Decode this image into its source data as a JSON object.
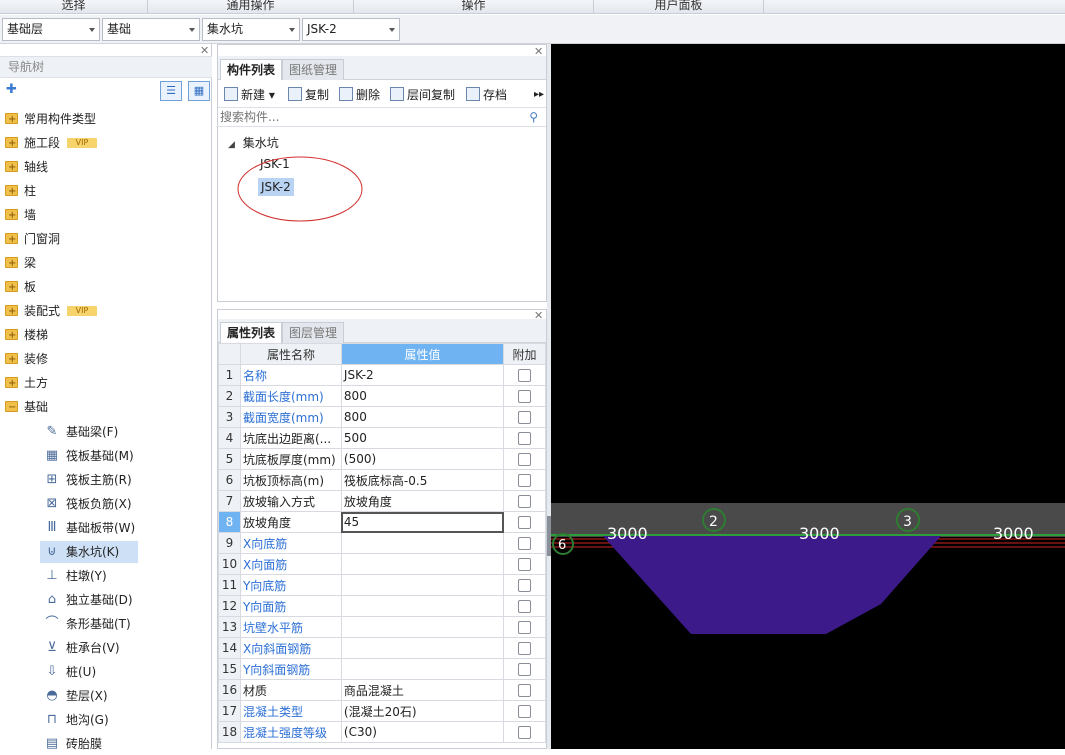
{
  "ribbon": {
    "groups": [
      "选择",
      "通用操作",
      "操作",
      "用户面板"
    ]
  },
  "combos": [
    "基础层",
    "基础",
    "集水坑",
    "JSK-2"
  ],
  "nav": {
    "title": "导航树",
    "categories": [
      {
        "label": "常用构件类型",
        "vip": ""
      },
      {
        "label": "施工段",
        "vip": "VIP"
      },
      {
        "label": "轴线",
        "vip": ""
      },
      {
        "label": "柱",
        "vip": ""
      },
      {
        "label": "墙",
        "vip": ""
      },
      {
        "label": "门窗洞",
        "vip": ""
      },
      {
        "label": "梁",
        "vip": ""
      },
      {
        "label": "板",
        "vip": ""
      },
      {
        "label": "装配式",
        "vip": "VIP"
      },
      {
        "label": "楼梯",
        "vip": ""
      },
      {
        "label": "装修",
        "vip": ""
      },
      {
        "label": "土方",
        "vip": ""
      },
      {
        "label": "基础",
        "vip": ""
      }
    ],
    "foundation_items": [
      "基础梁(F)",
      "筏板基础(M)",
      "筏板主筋(R)",
      "筏板负筋(X)",
      "基础板带(W)",
      "集水坑(K)",
      "柱墩(Y)",
      "独立基础(D)",
      "条形基础(T)",
      "桩承台(V)",
      "桩(U)",
      "垫层(X)",
      "地沟(G)",
      "砖胎膜"
    ],
    "selected_item": "集水坑(K)"
  },
  "component_panel": {
    "tabs": [
      "构件列表",
      "图纸管理"
    ],
    "toolbar": {
      "new": "新建",
      "copy": "复制",
      "delete": "删除",
      "layer_copy": "层间复制",
      "save": "存档"
    },
    "search_placeholder": "搜索构件...",
    "tree_root": "集水坑",
    "components": [
      "JSK-1",
      "JSK-2"
    ],
    "selected": "JSK-2"
  },
  "property_panel": {
    "tabs": [
      "属性列表",
      "图层管理"
    ],
    "headers": {
      "name": "属性名称",
      "value": "属性值",
      "extra": "附加"
    },
    "rows": [
      {
        "n": "1",
        "name": "名称",
        "value": "JSK-2",
        "blue": true
      },
      {
        "n": "2",
        "name": "截面长度(mm)",
        "value": "800",
        "blue": true
      },
      {
        "n": "3",
        "name": "截面宽度(mm)",
        "value": "800",
        "blue": true
      },
      {
        "n": "4",
        "name": "坑底出边距离(...",
        "value": "500",
        "blue": false
      },
      {
        "n": "5",
        "name": "坑底板厚度(mm)",
        "value": "(500)",
        "blue": false
      },
      {
        "n": "6",
        "name": "坑板顶标高(m)",
        "value": "筏板底标高-0.5",
        "blue": false
      },
      {
        "n": "7",
        "name": "放坡输入方式",
        "value": "放坡角度",
        "blue": false
      },
      {
        "n": "8",
        "name": "放坡角度",
        "value": "45",
        "blue": false
      },
      {
        "n": "9",
        "name": "X向底筋",
        "value": "",
        "blue": true
      },
      {
        "n": "10",
        "name": "X向面筋",
        "value": "",
        "blue": true
      },
      {
        "n": "11",
        "name": "Y向底筋",
        "value": "",
        "blue": true
      },
      {
        "n": "12",
        "name": "Y向面筋",
        "value": "",
        "blue": true
      },
      {
        "n": "13",
        "name": "坑壁水平筋",
        "value": "",
        "blue": true
      },
      {
        "n": "14",
        "name": "X向斜面钢筋",
        "value": "",
        "blue": true
      },
      {
        "n": "15",
        "name": "Y向斜面钢筋",
        "value": "",
        "blue": true
      },
      {
        "n": "16",
        "name": "材质",
        "value": "商品混凝土",
        "blue": false
      },
      {
        "n": "17",
        "name": "混凝土类型",
        "value": "(混凝土20石)",
        "blue": true
      },
      {
        "n": "18",
        "name": "混凝土强度等级",
        "value": "(C30)",
        "blue": true
      }
    ],
    "selected_row": "8"
  },
  "canvas": {
    "dims": [
      "3000",
      "3000",
      "3000"
    ],
    "axes": [
      "2",
      "3",
      "6"
    ],
    "colors": {
      "pit": "#3d1a8a",
      "band": "#4a4a4a",
      "axis": "#2e7d32",
      "rebar": "#d22020"
    }
  }
}
